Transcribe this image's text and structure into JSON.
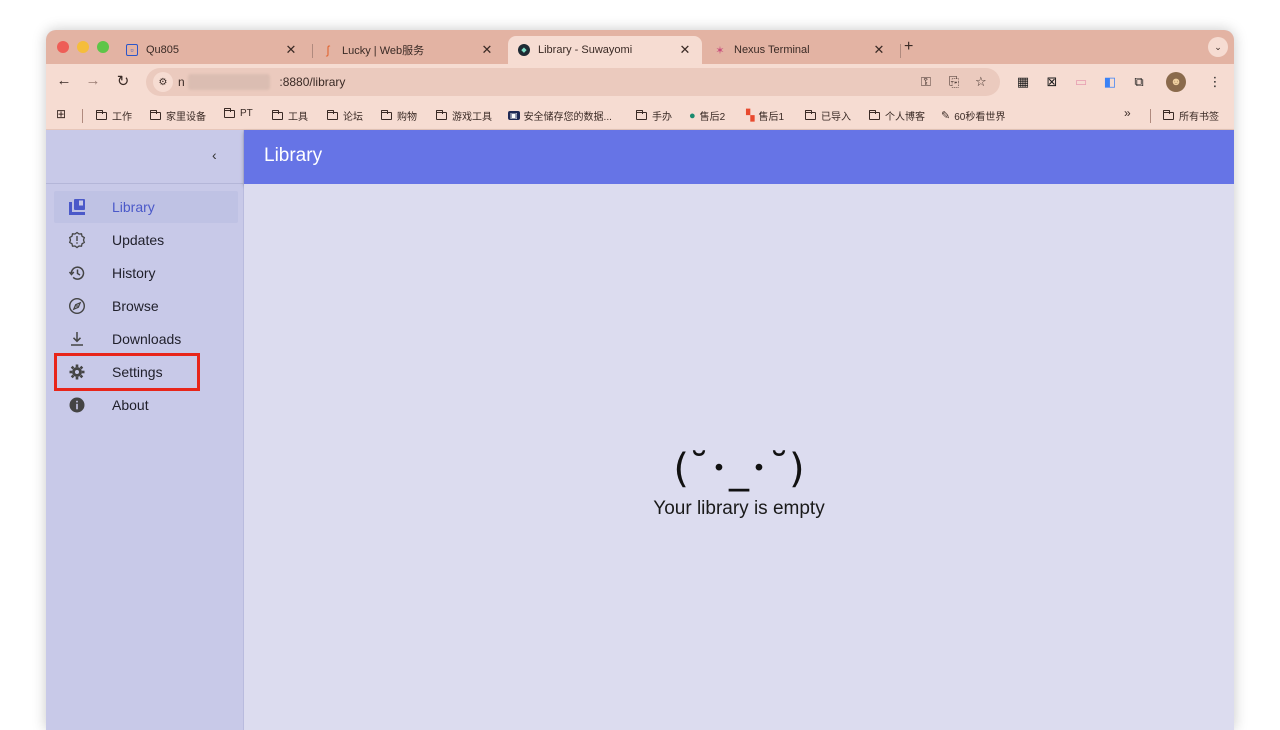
{
  "browser": {
    "tabs": [
      {
        "title": "Qu805",
        "icon": "app-square-icon",
        "active": false
      },
      {
        "title": "Lucky | Web服务",
        "icon": "lucky-icon",
        "active": false
      },
      {
        "title": "Library - Suwayomi",
        "icon": "suwayomi-icon",
        "active": true
      },
      {
        "title": "Nexus Terminal",
        "icon": "nexus-icon",
        "active": false
      }
    ],
    "url_prefix": "n",
    "url_suffix": ":8880/library",
    "bookmarks": [
      {
        "label": "工作",
        "type": "folder"
      },
      {
        "label": "家里设备",
        "type": "folder"
      },
      {
        "label": "PT",
        "type": "folder"
      },
      {
        "label": "工具",
        "type": "folder"
      },
      {
        "label": "论坛",
        "type": "folder"
      },
      {
        "label": "购物",
        "type": "folder"
      },
      {
        "label": "游戏工具",
        "type": "folder"
      },
      {
        "label": "安全储存您的数据...",
        "type": "link"
      },
      {
        "label": "手办",
        "type": "folder"
      },
      {
        "label": "售后2",
        "type": "link"
      },
      {
        "label": "售后1",
        "type": "link"
      },
      {
        "label": "已导入",
        "type": "folder"
      },
      {
        "label": "个人博客",
        "type": "folder"
      },
      {
        "label": "60秒看世界",
        "type": "link"
      }
    ],
    "overflow": "»",
    "all_bookmarks": "所有书签"
  },
  "app": {
    "title": "Library",
    "nav": [
      {
        "label": "Library",
        "icon": "library-icon",
        "active": true
      },
      {
        "label": "Updates",
        "icon": "updates-icon",
        "active": false
      },
      {
        "label": "History",
        "icon": "history-icon",
        "active": false
      },
      {
        "label": "Browse",
        "icon": "browse-compass-icon",
        "active": false
      },
      {
        "label": "Downloads",
        "icon": "download-icon",
        "active": false
      },
      {
        "label": "Settings",
        "icon": "gear-icon",
        "active": false
      },
      {
        "label": "About",
        "icon": "info-icon",
        "active": false
      }
    ],
    "empty_face": "(˘･_･˘)",
    "empty_message": "Your library is empty"
  },
  "colors": {
    "tabstrip": "#e3b3a3",
    "toolbar": "#f6dcd2",
    "sidebar": "#c8c9e8",
    "appbar": "#6674e6",
    "content": "#dcdcef",
    "active_nav_text": "#4b59c9",
    "highlight": "#e8251a"
  }
}
